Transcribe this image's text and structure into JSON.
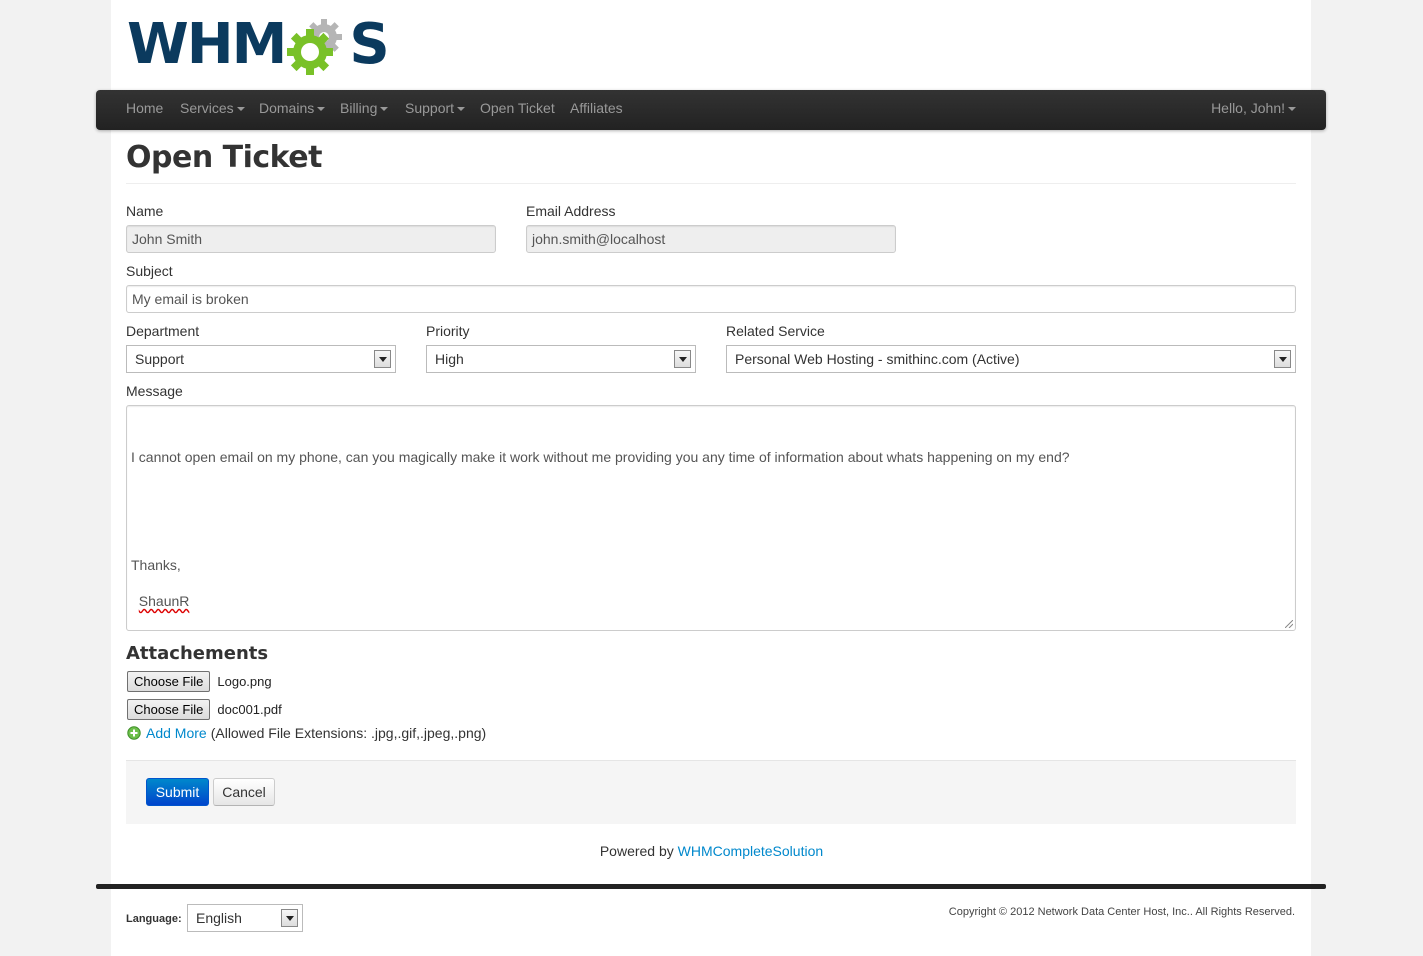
{
  "logo": {
    "text_left": "WHM",
    "text_right": "S",
    "text_color": "#0b3a5e",
    "gear_green": "#79c128",
    "gear_grey": "#b5b5b5"
  },
  "nav": {
    "items": [
      {
        "label": "Home",
        "dropdown": false
      },
      {
        "label": "Services",
        "dropdown": true
      },
      {
        "label": "Domains",
        "dropdown": true
      },
      {
        "label": "Billing",
        "dropdown": true
      },
      {
        "label": "Support",
        "dropdown": true
      },
      {
        "label": "Open Ticket",
        "dropdown": false
      },
      {
        "label": "Affiliates",
        "dropdown": false
      }
    ],
    "user_greeting": "Hello, John!"
  },
  "page_title": "Open Ticket",
  "form": {
    "name_label": "Name",
    "name_value": "John Smith",
    "email_label": "Email Address",
    "email_value": "john.smith@localhost",
    "subject_label": "Subject",
    "subject_value": "My email is broken",
    "department_label": "Department",
    "department_value": "Support",
    "priority_label": "Priority",
    "priority_value": "High",
    "related_service_label": "Related Service",
    "related_service_value": "Personal Web Hosting - smithinc.com (Active)",
    "message_label": "Message",
    "message_line1": "I cannot open email on my phone, can you magically make it work without me providing you any time of information about whats happening on my end?",
    "message_line2": "Thanks,",
    "message_line3": "ShaunR"
  },
  "attachments": {
    "title": "Attachements",
    "choose_file_label": "Choose File",
    "files": [
      "Logo.png",
      "doc001.pdf"
    ],
    "add_more_label": "Add More",
    "allowed_text": "(Allowed File Extensions: .jpg,.gif,.jpeg,.png)"
  },
  "actions": {
    "submit_label": "Submit",
    "cancel_label": "Cancel"
  },
  "footer": {
    "powered_by_prefix": "Powered by",
    "powered_by_link": "WHMCompleteSolution",
    "language_label": "Language:",
    "language_value": "English",
    "copyright": "Copyright © 2012 Network Data Center Host, Inc.. All Rights Reserved."
  },
  "colors": {
    "link": "#0088cc",
    "primary_button": "#0066cc",
    "navbar": "#2c2c2c"
  }
}
